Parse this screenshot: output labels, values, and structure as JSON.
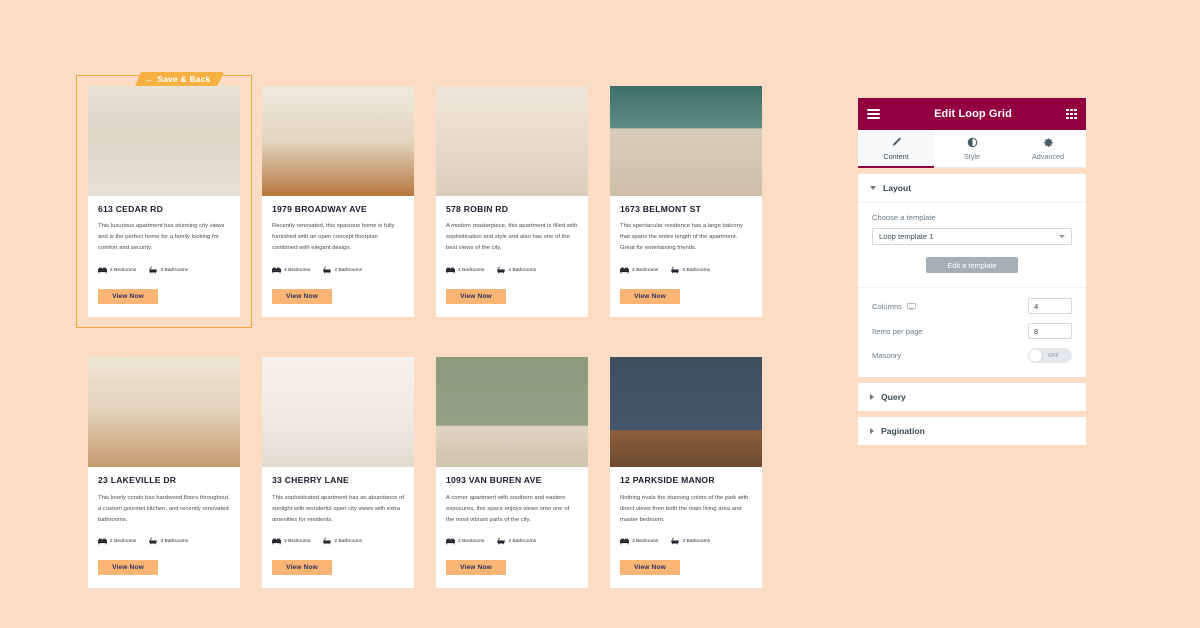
{
  "canvas": {
    "save_back": {
      "label": "Save & Back",
      "arrow": "←",
      "icon": "back-arrow-icon"
    },
    "spec_icons": {
      "bed": "bed-icon",
      "bath": "bathtub-icon"
    },
    "cards": [
      {
        "title": "613 CEDAR RD",
        "desc": "This luxurious apartment has stunning city views and is the perfect home for a family looking for comfort and security.",
        "bedrooms": "4 Bedrooms",
        "bathrooms": "3 Bathrooms",
        "button": "View Now",
        "selected": true,
        "image": "living-room-bright-windows"
      },
      {
        "title": "1979 BROADWAY AVE",
        "desc": "Recently renovated, this spacious home is fully furnished with an open concept floorplan combined with elegant design.",
        "bedrooms": "3 Bedrooms",
        "bathrooms": "2 Bathrooms",
        "button": "View Now",
        "selected": false,
        "image": "open-concept-wood-floor"
      },
      {
        "title": "578 ROBIN RD",
        "desc": "A modern masterpiece, this apartment is filled with sophistication and style and also has one of the best views of the city.",
        "bedrooms": "4 Bedrooms",
        "bathrooms": "2 Bathrooms",
        "button": "View Now",
        "selected": false,
        "image": "modern-curtains-tv-wall"
      },
      {
        "title": "1673 BELMONT ST",
        "desc": "This spectacular residence has a large balcony that spans the entire length of the apartment. Great for entertaining friends.",
        "bedrooms": "4 Bedrooms",
        "bathrooms": "3 Bathrooms",
        "button": "View Now",
        "selected": false,
        "image": "teal-wall-leather-sofa"
      },
      {
        "title": "23 LAKEVILLE DR",
        "desc": "This lovely condo has hardwood floors throughout, a custom gourmet kitchen, and recently renovated bathrooms.",
        "bedrooms": "4 Bedrooms",
        "bathrooms": "3 Bathrooms",
        "button": "View Now",
        "selected": false,
        "image": "warm-lounge-leather-chairs"
      },
      {
        "title": "33 CHERRY LANE",
        "desc": "This sophisticated apartment has an abundance of sunlight with wonderful open city views with extra amenities for residents.",
        "bedrooms": "3 Bedrooms",
        "bathrooms": "2 Bathrooms",
        "button": "View Now",
        "selected": false,
        "image": "sunlit-white-living-room"
      },
      {
        "title": "1093 VAN BUREN AVE",
        "desc": "A corner apartment with southern and eastern exposures, this space enjoys views onto one of the most vibrant parts of the city.",
        "bedrooms": "2 Bedrooms",
        "bathrooms": "2 Bathrooms",
        "button": "View Now",
        "selected": false,
        "image": "sage-green-wall-round-mirror"
      },
      {
        "title": "12 PARKSIDE MANOR",
        "desc": "Nothing rivals the stunning colors of the park with direct views from both the main living area and master bedroom.",
        "bedrooms": "3 Bedrooms",
        "bathrooms": "3 Bathrooms",
        "button": "View Now",
        "selected": false,
        "image": "navy-wall-tan-leather-sofa"
      }
    ]
  },
  "panel": {
    "title": "Edit Loop Grid",
    "menu_icon": "hamburger-menu-icon",
    "apps_icon": "grid-apps-icon",
    "tabs": [
      {
        "label": "Content",
        "icon": "pencil-icon",
        "active": true
      },
      {
        "label": "Style",
        "icon": "contrast-icon",
        "active": false
      },
      {
        "label": "Advanced",
        "icon": "gear-icon",
        "active": false
      }
    ],
    "sections": [
      {
        "label": "Layout",
        "open": true
      },
      {
        "label": "Query",
        "open": false
      },
      {
        "label": "Pagination",
        "open": false
      }
    ],
    "layout": {
      "template_label": "Choose a template",
      "template_value": "Loop template 1",
      "edit_template_button": "Edit a template",
      "columns_label": "Columns",
      "columns_device_icon": "desktop-icon",
      "columns_value": "4",
      "items_label": "Items per page",
      "items_value": "8",
      "masonry_label": "Masonry",
      "masonry_state": "OFF"
    }
  },
  "colors": {
    "background": "#FBDCC4",
    "panel_header": "#93003F",
    "accent_button": "#F9B573",
    "selection_border": "#F0A93A",
    "save_tab": "#F5B243"
  }
}
